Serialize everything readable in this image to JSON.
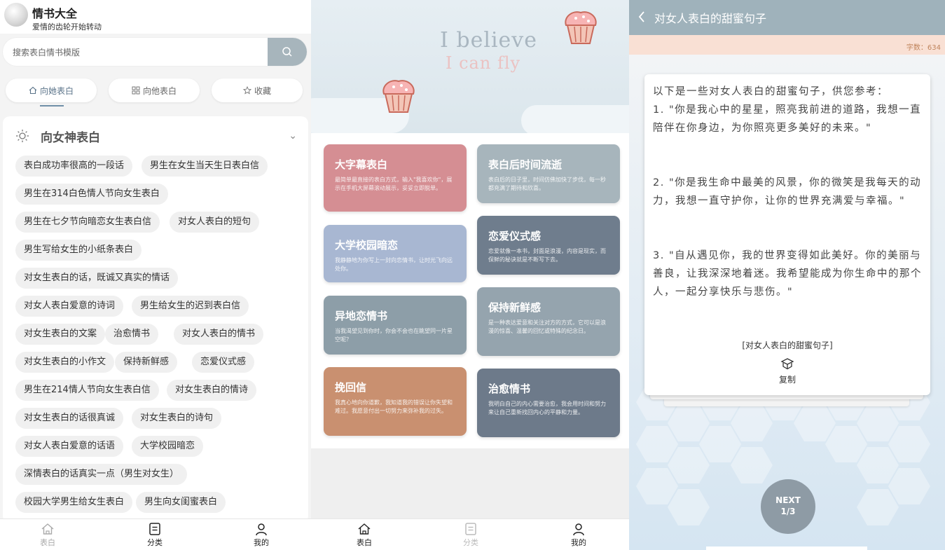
{
  "left": {
    "app": {
      "title": "情书大全",
      "subtitle": "爱情的齿轮开始转动"
    },
    "search": {
      "placeholder": "搜索表白情书模版"
    },
    "tabs": [
      {
        "label": "向她表白",
        "active": true
      },
      {
        "label": "向他表白"
      },
      {
        "label": "收藏"
      }
    ],
    "category": {
      "title": "向女神表白"
    },
    "chips": [
      "表白成功率很高的一段话",
      "男生在女生当天生日表白信",
      "男生在314白色情人节向女生表白",
      "男生在七夕节向暗恋女生表白信",
      "对女人表白的短句",
      "男生写给女生的小纸条表白",
      "对女生表白的话，既诚又真实的情话",
      "对女人表白爱意的诗词",
      "男生给女生的迟到表白信",
      "对女生表白的文案",
      "治愈情书",
      "对女人表白的情书",
      "对女生表白的小作文",
      "保持新鲜感",
      "恋爱仪式感",
      "男生在214情人节向女生表白信",
      "对女生表白的情诗",
      "对女生表白的话很真诚",
      "对女生表白的诗句",
      "对女人表白爱意的话语",
      "大学校园暗恋",
      "深情表白的话真实一点（男生对女生）",
      "校园大学男生给女生表白",
      "男生向女闺蜜表白"
    ],
    "nav": [
      {
        "label": "表白",
        "icon": "home-icon",
        "active": true
      },
      {
        "label": "分类",
        "icon": "list-icon"
      },
      {
        "label": "我的",
        "icon": "person-icon"
      }
    ]
  },
  "middle": {
    "banner": {
      "line1": "I believe",
      "line2": "I can fly"
    },
    "cards": [
      {
        "title": "大字幕表白",
        "desc": "最简单最直接的表白方式，输入\"我喜欢你\"，展示在手机大屏幕滚动展示，妥妥立即脱单。",
        "color": "#d58e93"
      },
      {
        "title": "表白后时间流逝",
        "desc": "表白后的日子里，时间仿佛加快了步伐，每一秒都充满了期待和欣喜。",
        "color": "#a7b5bc"
      },
      {
        "title": "大学校园暗恋",
        "desc": "我静静地为你写上一封向恋情书，让时光飞向远处你。",
        "color": "#a8b7d2"
      },
      {
        "title": "恋爱仪式感",
        "desc": "恋爱就像一本书，封面是浪漫，内容是现实，而保鲜的秘诀就是不断写下去。",
        "color": "#6f7d8d"
      },
      {
        "title": "异地恋情书",
        "desc": "当我渴望见到你时，你会不会也在眺望同一片星空呢？",
        "color": "#8d9ea8"
      },
      {
        "title": "保持新鲜感",
        "desc": "是一种表达爱意和关注对方的方式，它可以是浪漫的惊喜、温馨的回忆或特殊的纪念日。",
        "color": "#95a4ae"
      },
      {
        "title": "挽回信",
        "desc": "我真心地向你道歉，我知道我的错误让你失望和难过。我愿意付出一切努力来弥补我的过失。",
        "color": "#c99070"
      },
      {
        "title": "治愈情书",
        "desc": "我明白自己的内心需要治愈，我会用时间和努力来让自己重新找回内心的平静和力量。",
        "color": "#6d7a8a"
      }
    ],
    "nav": [
      {
        "label": "表白",
        "icon": "home-icon",
        "active": true
      },
      {
        "label": "分类",
        "icon": "list-icon"
      },
      {
        "label": "我的",
        "icon": "person-icon"
      }
    ]
  },
  "right": {
    "header": {
      "title": "对女人表白的甜蜜句子"
    },
    "word_count": "字数：634",
    "content": "以下是一些对女人表白的甜蜜句子，供您参考：\n1. \"你是我心中的星星，照亮我前进的道路，我想一直陪伴在你身边，为你照亮更多美好的未来。\"\n\n\n2. \"你是我生命中最美的风景，你的微笑是我每天的动力，我想一直守护你，让你的世界充满爱与幸福。\"\n\n\n3. \"自从遇见你，我的世界变得如此美好。你的美丽与善良，让我深深地着迷。我希望能成为你生命中的那个人，一起分享快乐与悲伤。\"",
    "tag": "[对女人表白的甜蜜句子]",
    "copy_label": "复制",
    "next": {
      "label": "NEXT",
      "page": "1/3"
    }
  }
}
